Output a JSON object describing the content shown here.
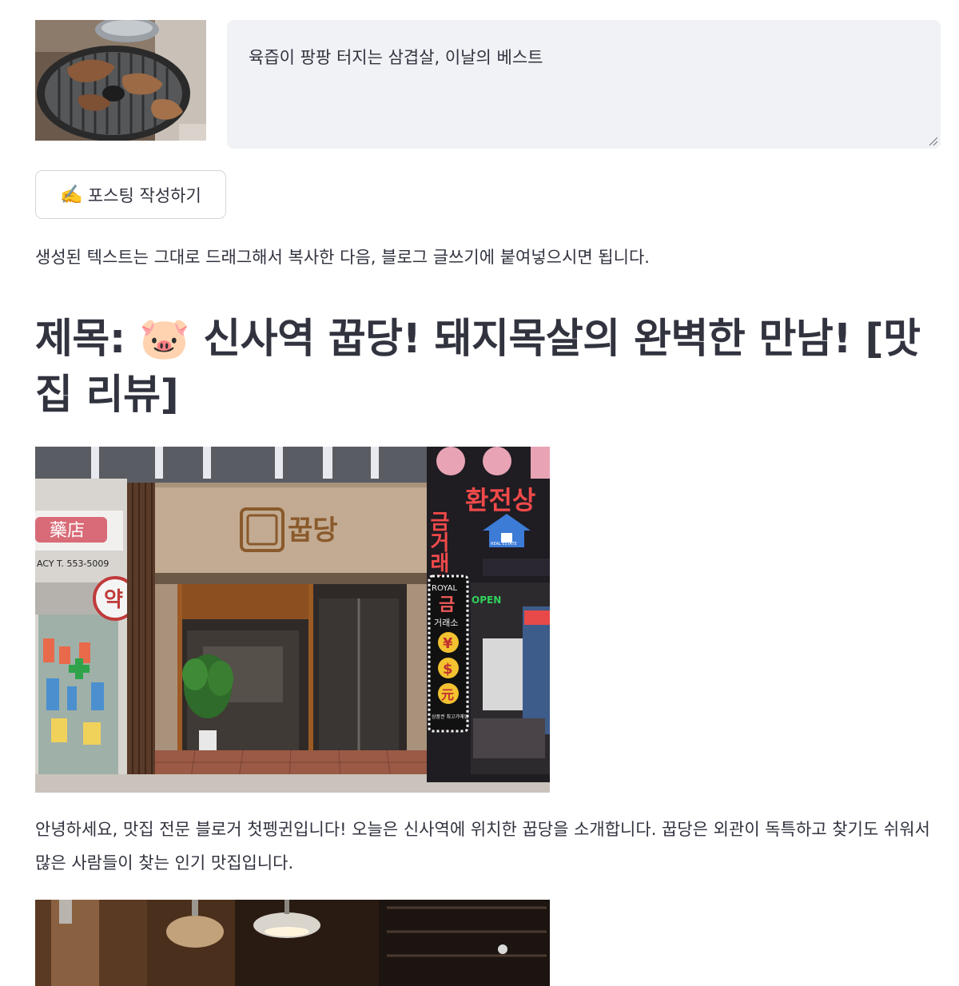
{
  "input": {
    "prompt_text": "육즙이 팡팡 터지는 삼겹살, 이날의 베스트"
  },
  "post_button": {
    "icon": "✍️",
    "label": "포스팅 작성하기"
  },
  "hint": "생성된 텍스트는 그대로 드래그해서 복사한 다음, 블로그 글쓰기에 붙여넣으시면 됩니다.",
  "post": {
    "title": "제목: 🐷 신사역 꿉당! 돼지목살의 완벽한 만남! [맛집 리뷰]",
    "intro": "안녕하세요, 맛집 전문 블로거 첫펭귄입니다! 오늘은 신사역에 위치한 꿉당을 소개합니다. 꿉당은 외관이 독특하고 찾기도 쉬워서 많은 사람들이 찾는 인기 맛집입니다."
  },
  "storefront_photo": {
    "shop_sign": "꿉당",
    "pharmacy_sign": "藥店",
    "pharmacy_phone": "ACY T. 553-5009",
    "yak_sign": "약",
    "gold_sign": "금거래소",
    "exchange_sign": "환전상",
    "royal_sign_top": "ROYAL",
    "royal_sign_gold": "금",
    "royal_sign_sub": "거래소",
    "royal_symbols": [
      "¥",
      "$",
      "元"
    ],
    "royal_sign_bottom": "상품권 최고가매입",
    "real_estate": "REAL ESTATE",
    "open_sign": "OPEN"
  }
}
